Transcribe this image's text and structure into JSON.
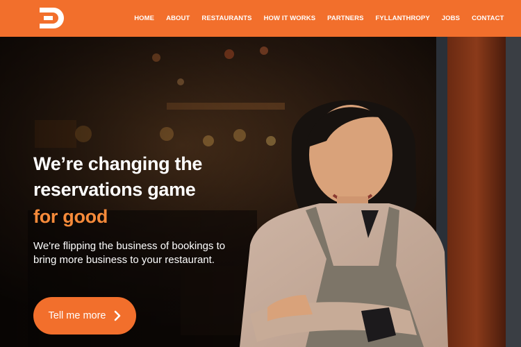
{
  "brand": {
    "logo_icon": "brand-logo-icon",
    "accent_color": "#f26f2c",
    "highlight_color": "#f58a3a"
  },
  "nav": {
    "items": [
      {
        "label": "HOME"
      },
      {
        "label": "ABOUT"
      },
      {
        "label": "RESTAURANTS"
      },
      {
        "label": "HOW IT WORKS"
      },
      {
        "label": "PARTNERS"
      },
      {
        "label": "FYLLANTHROPY"
      },
      {
        "label": "JOBS"
      },
      {
        "label": "CONTACT"
      }
    ]
  },
  "hero": {
    "headline_line1": "We’re changing the",
    "headline_line2": "reservations game",
    "headline_accent": "for good",
    "subtext": "We're flipping the business of bookings to bring more business to your restaurant.",
    "cta_label": "Tell me more",
    "cta_icon": "chevron-right-icon",
    "image_icon": "restaurant-owner-photo"
  }
}
